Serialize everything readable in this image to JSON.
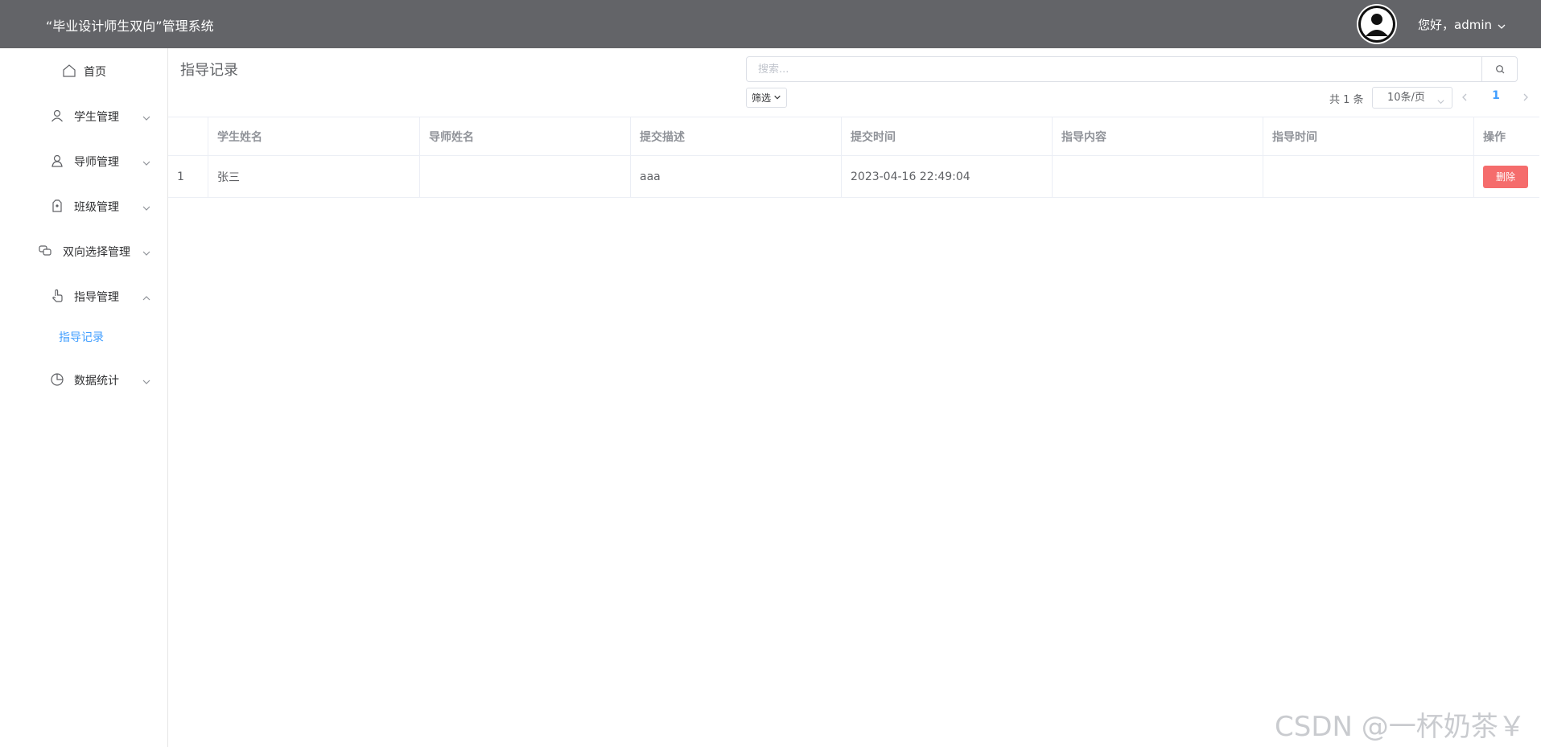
{
  "header": {
    "title": "“毕业设计师生双向”管理系统",
    "user_greeting": "您好，admin",
    "avatar_icon": "user-avatar-icon"
  },
  "sidebar": {
    "items": [
      {
        "label": "首页",
        "icon": "home-icon"
      },
      {
        "label": "学生管理",
        "icon": "user-icon",
        "arrow": "chevron-down-icon"
      },
      {
        "label": "导师管理",
        "icon": "teacher-icon",
        "arrow": "chevron-down-icon"
      },
      {
        "label": "班级管理",
        "icon": "badge-icon",
        "arrow": "chevron-down-icon"
      },
      {
        "label": "双向选择管理",
        "icon": "chat-icon",
        "arrow": "chevron-down-icon"
      },
      {
        "label": "指导管理",
        "icon": "pointer-icon",
        "arrow": "chevron-up-icon",
        "expanded": true
      },
      {
        "label": "指导记录",
        "active": true
      },
      {
        "label": "数据统计",
        "icon": "pie-chart-icon",
        "arrow": "chevron-down-icon"
      }
    ]
  },
  "main": {
    "page_title": "指导记录",
    "search": {
      "placeholder": "搜索...",
      "value": ""
    },
    "filter_label": "筛选",
    "pagination": {
      "total_text": "共 1 条",
      "page_size": "10条/页",
      "current_page": "1"
    },
    "table": {
      "columns": [
        "",
        "学生姓名",
        "导师姓名",
        "提交描述",
        "提交时间",
        "指导内容",
        "指导时间",
        "操作"
      ],
      "rows": [
        {
          "index": "1",
          "student": "张三",
          "teacher": "",
          "description": "aaa",
          "submit_time": "2023-04-16 22:49:04",
          "guide_content": "",
          "guide_time": "",
          "action": "删除"
        }
      ]
    }
  },
  "watermark": "CSDN @一杯奶茶￥",
  "colors": {
    "header_bg": "#636468",
    "accent": "#409eff",
    "danger": "#f56c6c"
  }
}
